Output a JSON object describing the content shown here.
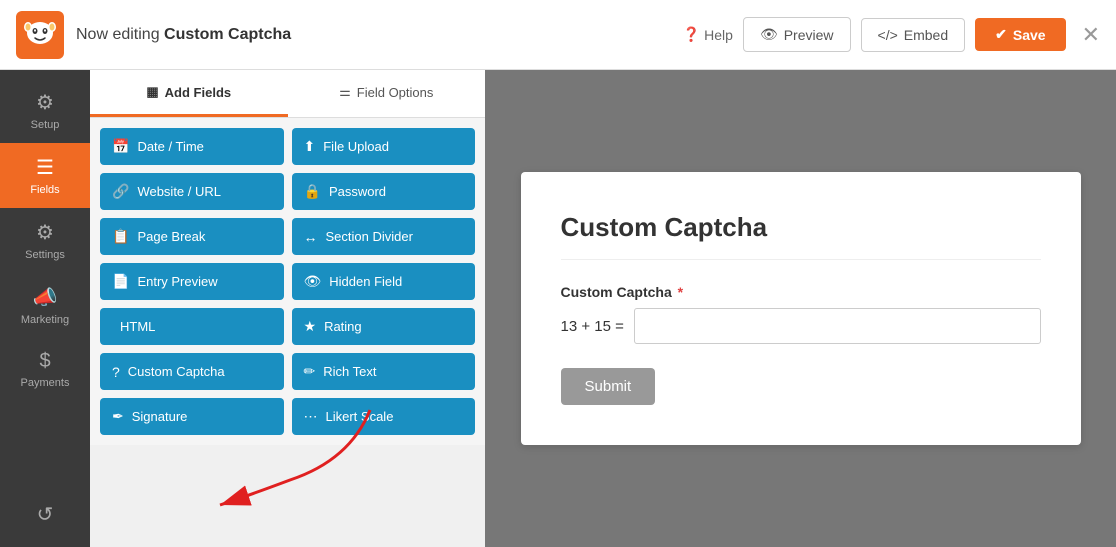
{
  "topbar": {
    "title_prefix": "Now editing ",
    "title_bold": "Custom Captcha",
    "help_label": "Help",
    "preview_label": "Preview",
    "embed_label": "Embed",
    "save_label": "Save"
  },
  "sidebar": {
    "items": [
      {
        "id": "setup",
        "label": "Setup",
        "icon": "⚙"
      },
      {
        "id": "fields",
        "label": "Fields",
        "icon": "☰",
        "active": true
      },
      {
        "id": "settings",
        "label": "Settings",
        "icon": "⚙"
      },
      {
        "id": "marketing",
        "label": "Marketing",
        "icon": "📣"
      },
      {
        "id": "payments",
        "label": "Payments",
        "icon": "$"
      }
    ],
    "bottom_icon": "↺"
  },
  "fields_panel": {
    "tab_add": "Add Fields",
    "tab_options": "Field Options",
    "buttons": [
      {
        "id": "date-time",
        "label": "Date / Time",
        "icon": "📅"
      },
      {
        "id": "file-upload",
        "label": "File Upload",
        "icon": "⬆"
      },
      {
        "id": "website-url",
        "label": "Website / URL",
        "icon": "🔗"
      },
      {
        "id": "password",
        "label": "Password",
        "icon": "🔒"
      },
      {
        "id": "page-break",
        "label": "Page Break",
        "icon": "📋"
      },
      {
        "id": "section-divider",
        "label": "Section Divider",
        "icon": "↔"
      },
      {
        "id": "entry-preview",
        "label": "Entry Preview",
        "icon": "📄"
      },
      {
        "id": "hidden-field",
        "label": "Hidden Field",
        "icon": "👁"
      },
      {
        "id": "html",
        "label": "HTML",
        "icon": "</>"
      },
      {
        "id": "rating",
        "label": "Rating",
        "icon": "★"
      },
      {
        "id": "custom-captcha",
        "label": "Custom Captcha",
        "icon": "?"
      },
      {
        "id": "rich-text",
        "label": "Rich Text",
        "icon": "✏"
      },
      {
        "id": "signature",
        "label": "Signature",
        "icon": "✒"
      },
      {
        "id": "likert-scale",
        "label": "Likert Scale",
        "icon": "⋯"
      }
    ]
  },
  "form_preview": {
    "title": "Custom Captcha",
    "field_label": "Custom Captcha",
    "required_mark": "*",
    "captcha_equation": "13 + 15 =",
    "captcha_input_value": "",
    "submit_label": "Submit"
  }
}
